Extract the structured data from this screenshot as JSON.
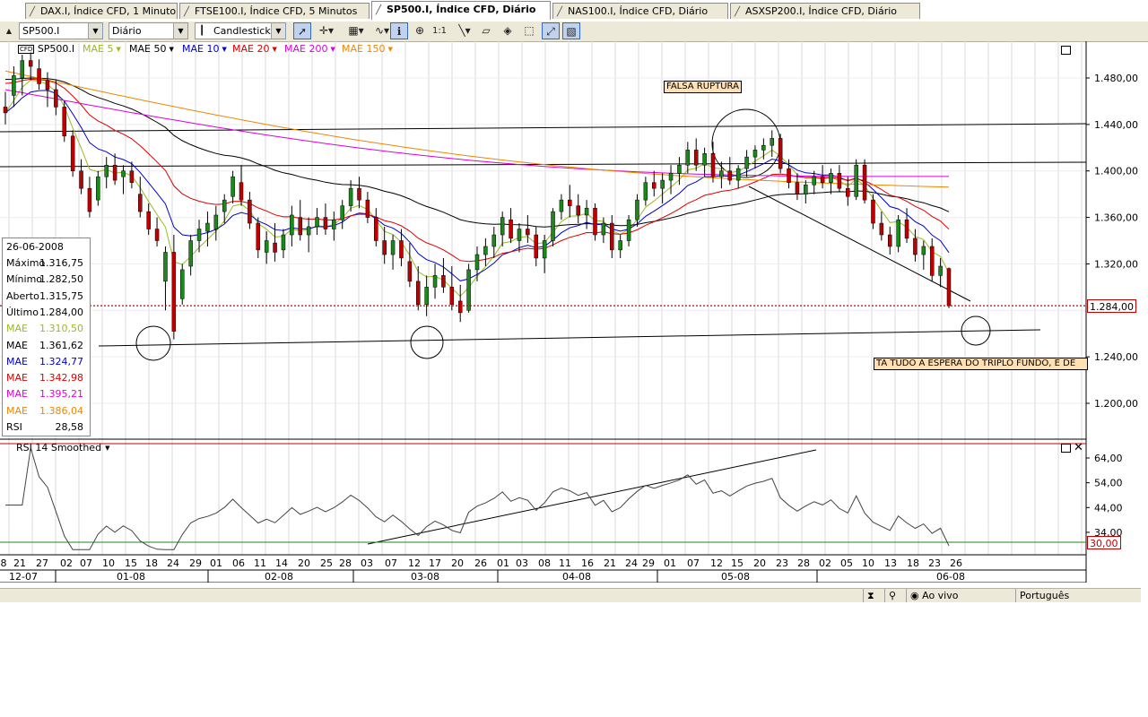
{
  "tabs": [
    {
      "label": "DAX.I, Índice CFD, 1 Minuto",
      "active": false
    },
    {
      "label": "FTSE100.I, Índice CFD, 5 Minutos",
      "active": false
    },
    {
      "label": "SP500.I, Índice CFD, Diário",
      "active": true
    },
    {
      "label": "NAS100.I, Índice CFD, Diário",
      "active": false
    },
    {
      "label": "ASXSP200.I, Índice CFD, Diário",
      "active": false
    }
  ],
  "toolbar": {
    "symbol": "SP500.I",
    "period": "Diário",
    "chart_type": "Candlestick",
    "tools": [
      "pointer-icon",
      "crosshair-icon",
      "grid-icon",
      "indicator-icon",
      "info-icon",
      "zoom-icon",
      "one-to-one-icon",
      "line-tool-icon",
      "eraser-icon",
      "paint-icon",
      "fit-icon",
      "autoscale-icon"
    ]
  },
  "legend": {
    "cfd_badge": "CFD",
    "symbol": "SP500.I",
    "items": [
      {
        "label": "MAE 5",
        "color": "#99bb22"
      },
      {
        "label": "MAE 50",
        "color": "#000000"
      },
      {
        "label": "MAE 10",
        "color": "#0000cc"
      },
      {
        "label": "MAE 20",
        "color": "#dd0000"
      },
      {
        "label": "MAE 200",
        "color": "#dd00dd"
      },
      {
        "label": "MAE 150",
        "color": "#ee8800"
      }
    ]
  },
  "info_box": {
    "date": "26-06-2008",
    "rows": [
      {
        "label": "Máximo",
        "value": "1.316,75",
        "color": "#000000"
      },
      {
        "label": "Mínimo",
        "value": "1.282,50",
        "color": "#000000"
      },
      {
        "label": "Aberto",
        "value": "1.315,75",
        "color": "#000000"
      },
      {
        "label": "Último",
        "value": "1.284,00",
        "color": "#000000"
      },
      {
        "label": "MAE",
        "value": "1.310,50",
        "color": "#99bb22"
      },
      {
        "label": "MAE",
        "value": "1.361,62",
        "color": "#000000"
      },
      {
        "label": "MAE",
        "value": "1.324,77",
        "color": "#0000cc"
      },
      {
        "label": "MAE",
        "value": "1.342,98",
        "color": "#dd0000"
      },
      {
        "label": "MAE",
        "value": "1.395,21",
        "color": "#dd00dd"
      },
      {
        "label": "MAE",
        "value": "1.386,04",
        "color": "#ee8800"
      },
      {
        "label": "RSI",
        "value": "28,58",
        "color": "#000000"
      }
    ]
  },
  "annotations": {
    "falsa_ruptura": "FALSA RUPTURA",
    "triplo_fundo": "TA TUDO A ESPERA DO TRIPLO FUNDO, E DE"
  },
  "price_axis": {
    "labels": [
      "1.480,00",
      "1.440,00",
      "1.400,00",
      "1.360,00",
      "1.320,00",
      "1.284,00",
      "1.240,00",
      "1.200,00"
    ],
    "last_price": "1.284,00"
  },
  "rsi": {
    "title": "RSI 14 Smoothed",
    "axis_labels": [
      "64,00",
      "54,00",
      "44,00",
      "34,00"
    ],
    "level": "30,00"
  },
  "date_axis": {
    "days": [
      "8",
      "21",
      "27",
      "02",
      "07",
      "10",
      "15",
      "18",
      "24",
      "29",
      "01",
      "06",
      "11",
      "14",
      "20",
      "25",
      "28",
      "03",
      "07",
      "12",
      "17",
      "20",
      "26",
      "01",
      "03",
      "08",
      "11",
      "16",
      "21",
      "24",
      "29",
      "01",
      "07",
      "12",
      "15",
      "20",
      "23",
      "28",
      "02",
      "05",
      "10",
      "13",
      "18",
      "23",
      "26"
    ],
    "months": [
      "12-07",
      "01-08",
      "02-08",
      "03-08",
      "04-08",
      "05-08",
      "06-08"
    ]
  },
  "status_bar": {
    "live": "Ao vivo",
    "language": "Português"
  },
  "chart_data": {
    "type": "candlestick",
    "symbol": "SP500.I",
    "period": "Diário",
    "ylim": [
      1160,
      1500
    ],
    "last_close": 1284.0,
    "ohlc": [
      [
        1455,
        1468,
        1440,
        1450
      ],
      [
        1465,
        1490,
        1455,
        1482
      ],
      [
        1480,
        1500,
        1465,
        1495
      ],
      [
        1495,
        1502,
        1478,
        1490
      ],
      [
        1488,
        1496,
        1470,
        1475
      ],
      [
        1478,
        1485,
        1455,
        1470
      ],
      [
        1470,
        1478,
        1448,
        1455
      ],
      [
        1455,
        1460,
        1425,
        1430
      ],
      [
        1430,
        1435,
        1395,
        1400
      ],
      [
        1400,
        1410,
        1380,
        1385
      ],
      [
        1385,
        1395,
        1360,
        1365
      ],
      [
        1375,
        1400,
        1370,
        1395
      ],
      [
        1395,
        1412,
        1385,
        1405
      ],
      [
        1405,
        1415,
        1388,
        1392
      ],
      [
        1395,
        1405,
        1380,
        1400
      ],
      [
        1400,
        1408,
        1385,
        1390
      ],
      [
        1380,
        1395,
        1360,
        1365
      ],
      [
        1365,
        1372,
        1345,
        1350
      ],
      [
        1350,
        1360,
        1335,
        1340
      ],
      [
        1305,
        1335,
        1280,
        1330
      ],
      [
        1330,
        1345,
        1255,
        1262
      ],
      [
        1290,
        1320,
        1285,
        1315
      ],
      [
        1318,
        1345,
        1310,
        1340
      ],
      [
        1340,
        1358,
        1330,
        1350
      ],
      [
        1348,
        1365,
        1335,
        1355
      ],
      [
        1350,
        1370,
        1340,
        1362
      ],
      [
        1365,
        1380,
        1355,
        1375
      ],
      [
        1378,
        1400,
        1372,
        1395
      ],
      [
        1390,
        1405,
        1370,
        1375
      ],
      [
        1375,
        1382,
        1350,
        1355
      ],
      [
        1355,
        1360,
        1325,
        1332
      ],
      [
        1330,
        1348,
        1320,
        1340
      ],
      [
        1338,
        1355,
        1322,
        1330
      ],
      [
        1332,
        1350,
        1325,
        1345
      ],
      [
        1345,
        1370,
        1335,
        1362
      ],
      [
        1360,
        1375,
        1340,
        1345
      ],
      [
        1345,
        1360,
        1330,
        1352
      ],
      [
        1352,
        1368,
        1345,
        1360
      ],
      [
        1360,
        1372,
        1345,
        1350
      ],
      [
        1350,
        1365,
        1340,
        1358
      ],
      [
        1358,
        1375,
        1350,
        1370
      ],
      [
        1370,
        1392,
        1365,
        1385
      ],
      [
        1385,
        1395,
        1368,
        1375
      ],
      [
        1375,
        1382,
        1355,
        1360
      ],
      [
        1360,
        1368,
        1335,
        1340
      ],
      [
        1340,
        1352,
        1320,
        1328
      ],
      [
        1328,
        1345,
        1315,
        1340
      ],
      [
        1340,
        1350,
        1318,
        1325
      ],
      [
        1322,
        1338,
        1300,
        1305
      ],
      [
        1305,
        1318,
        1280,
        1285
      ],
      [
        1285,
        1310,
        1275,
        1300
      ],
      [
        1300,
        1320,
        1290,
        1310
      ],
      [
        1310,
        1325,
        1295,
        1300
      ],
      [
        1300,
        1318,
        1280,
        1285
      ],
      [
        1288,
        1302,
        1270,
        1278
      ],
      [
        1280,
        1320,
        1278,
        1315
      ],
      [
        1315,
        1335,
        1305,
        1328
      ],
      [
        1328,
        1342,
        1318,
        1335
      ],
      [
        1335,
        1352,
        1325,
        1345
      ],
      [
        1345,
        1365,
        1335,
        1360
      ],
      [
        1358,
        1368,
        1338,
        1342
      ],
      [
        1340,
        1355,
        1330,
        1350
      ],
      [
        1350,
        1362,
        1338,
        1345
      ],
      [
        1345,
        1352,
        1318,
        1325
      ],
      [
        1325,
        1345,
        1312,
        1340
      ],
      [
        1340,
        1368,
        1335,
        1365
      ],
      [
        1365,
        1380,
        1358,
        1375
      ],
      [
        1375,
        1388,
        1360,
        1370
      ],
      [
        1370,
        1380,
        1355,
        1362
      ],
      [
        1362,
        1375,
        1350,
        1368
      ],
      [
        1368,
        1372,
        1340,
        1345
      ],
      [
        1345,
        1360,
        1338,
        1355
      ],
      [
        1355,
        1362,
        1325,
        1332
      ],
      [
        1332,
        1345,
        1325,
        1340
      ],
      [
        1340,
        1362,
        1335,
        1358
      ],
      [
        1358,
        1380,
        1352,
        1375
      ],
      [
        1375,
        1395,
        1370,
        1390
      ],
      [
        1390,
        1400,
        1378,
        1385
      ],
      [
        1385,
        1398,
        1372,
        1392
      ],
      [
        1392,
        1405,
        1380,
        1398
      ],
      [
        1398,
        1412,
        1388,
        1405
      ],
      [
        1405,
        1425,
        1398,
        1418
      ],
      [
        1418,
        1428,
        1400,
        1405
      ],
      [
        1405,
        1420,
        1395,
        1415
      ],
      [
        1415,
        1425,
        1390,
        1395
      ],
      [
        1395,
        1408,
        1385,
        1400
      ],
      [
        1400,
        1412,
        1388,
        1392
      ],
      [
        1392,
        1405,
        1385,
        1402
      ],
      [
        1402,
        1418,
        1395,
        1412
      ],
      [
        1412,
        1422,
        1402,
        1418
      ],
      [
        1418,
        1428,
        1410,
        1422
      ],
      [
        1422,
        1435,
        1412,
        1428
      ],
      [
        1428,
        1432,
        1398,
        1402
      ],
      [
        1402,
        1410,
        1385,
        1390
      ],
      [
        1390,
        1398,
        1375,
        1380
      ],
      [
        1380,
        1392,
        1372,
        1388
      ],
      [
        1388,
        1400,
        1380,
        1395
      ],
      [
        1395,
        1405,
        1385,
        1390
      ],
      [
        1390,
        1402,
        1380,
        1398
      ],
      [
        1398,
        1405,
        1382,
        1385
      ],
      [
        1385,
        1395,
        1370,
        1378
      ],
      [
        1378,
        1410,
        1375,
        1405
      ],
      [
        1405,
        1410,
        1372,
        1375
      ],
      [
        1375,
        1380,
        1350,
        1355
      ],
      [
        1355,
        1365,
        1340,
        1345
      ],
      [
        1345,
        1352,
        1328,
        1335
      ],
      [
        1335,
        1362,
        1330,
        1358
      ],
      [
        1358,
        1368,
        1338,
        1342
      ],
      [
        1342,
        1350,
        1322,
        1328
      ],
      [
        1328,
        1340,
        1315,
        1335
      ],
      [
        1335,
        1342,
        1305,
        1310
      ],
      [
        1310,
        1325,
        1300,
        1318
      ],
      [
        1316,
        1317,
        1282,
        1284
      ]
    ],
    "moving_averages": [
      {
        "name": "MAE 5",
        "color": "#99bb22",
        "last": 1310.5
      },
      {
        "name": "MAE 50",
        "color": "#000000",
        "last": 1361.62
      },
      {
        "name": "MAE 10",
        "color": "#0000cc",
        "last": 1324.77
      },
      {
        "name": "MAE 20",
        "color": "#dd0000",
        "last": 1342.98
      },
      {
        "name": "MAE 200",
        "color": "#dd00dd",
        "last": 1395.21
      },
      {
        "name": "MAE 150",
        "color": "#ee8800",
        "last": 1386.04
      }
    ],
    "rsi": {
      "name": "RSI 14 Smoothed",
      "ylim": [
        26,
        70
      ],
      "last": 28.58,
      "level": 30
    }
  }
}
